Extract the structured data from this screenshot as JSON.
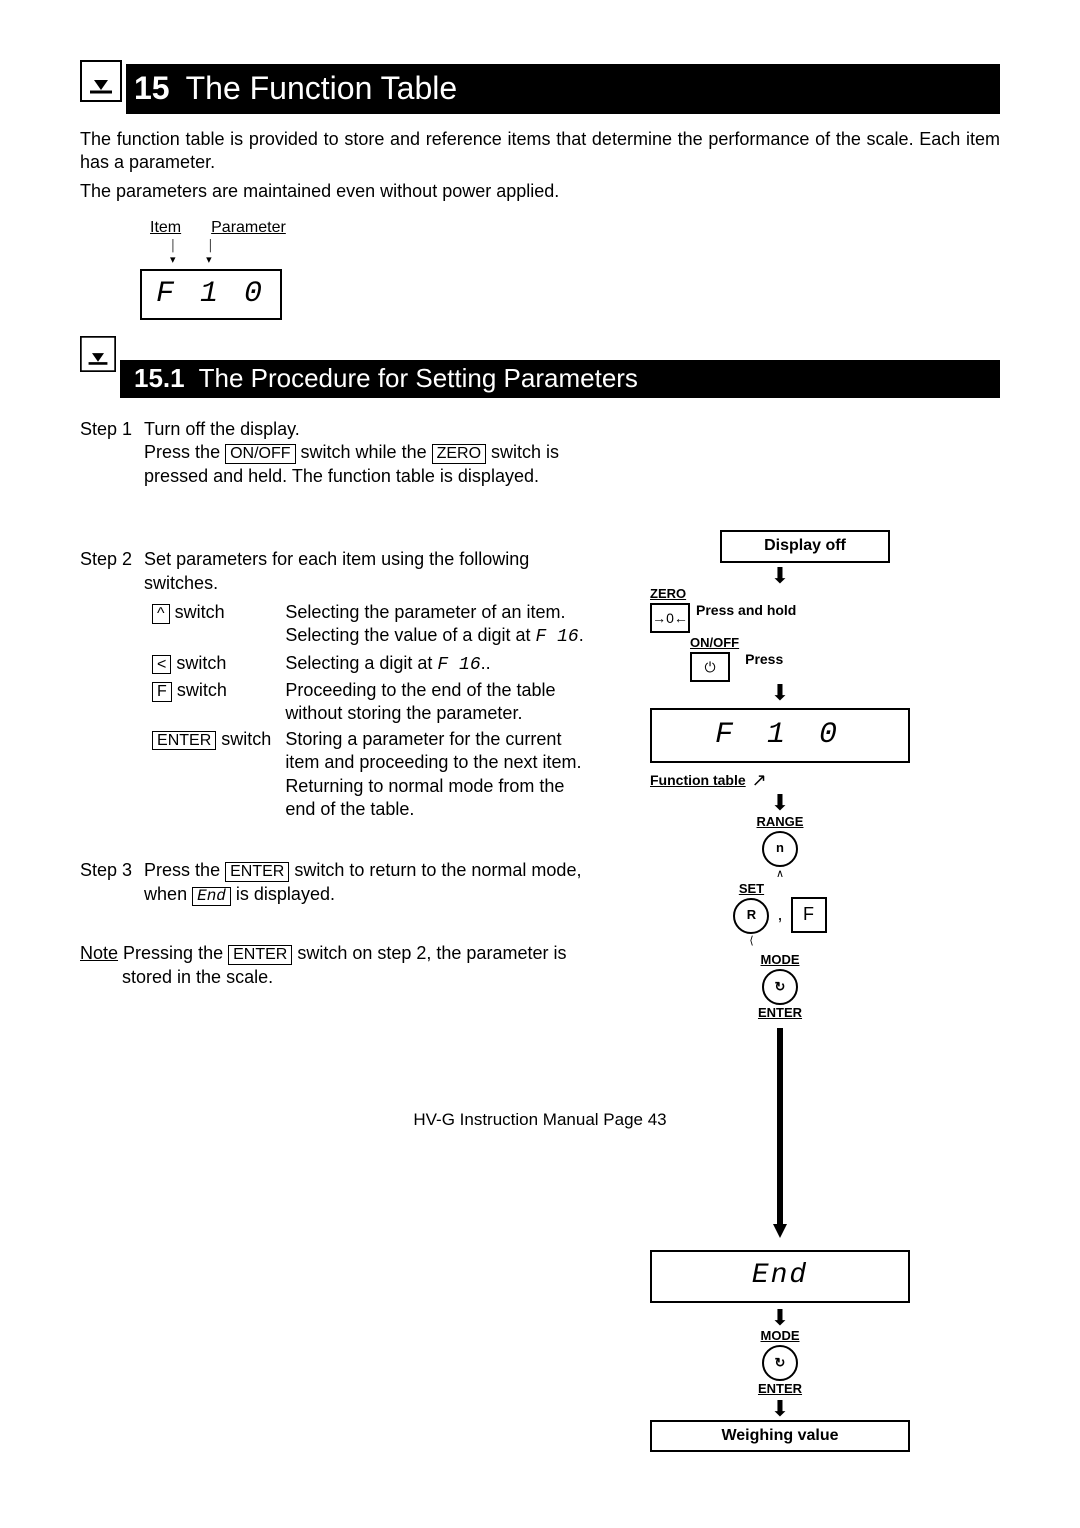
{
  "heading": {
    "number": "15",
    "title": "The Function Table"
  },
  "intro": {
    "p1": "The function table is provided to store and reference items that determine the performance of the scale. Each item has a parameter.",
    "p2": "The parameters are maintained even without power applied."
  },
  "item_param": {
    "item_label": "Item",
    "param_label": "Parameter",
    "display": "F  1  0"
  },
  "sub": {
    "number": "15.1",
    "title": "The Procedure for Setting Parameters"
  },
  "step1": {
    "label": "Step 1",
    "l1a": "Turn off the display.",
    "l2a": "Press the ",
    "key_onoff": "ON/OFF",
    "l2b": " switch while the ",
    "key_zero": "ZERO",
    "l2c": " switch is",
    "l3": "pressed and held. The function table is displayed."
  },
  "step2": {
    "label": "Step  2",
    "intro1": "Set parameters for each item using the following",
    "intro2": "switches.",
    "rows": [
      {
        "key": "^",
        "suffix": "switch",
        "desc1": "Selecting the parameter of an item.",
        "desc2a": "Selecting the value of a digit at ",
        "code": "F 16",
        "desc2b": "."
      },
      {
        "key": "<",
        "suffix": "switch",
        "desc1a": "Selecting a digit at ",
        "code": "F 16",
        "desc1b": ".."
      },
      {
        "key": "F",
        "suffix": "switch",
        "desc1": "Proceeding to the end of the table",
        "desc2": "without storing the parameter."
      },
      {
        "key": "ENTER",
        "suffix": "switch",
        "desc1": "Storing a parameter for the current",
        "desc2": "item and proceeding to the next item.",
        "desc3": "Returning to normal mode from the",
        "desc4": "end of the table."
      }
    ]
  },
  "step3": {
    "label": "Step  3",
    "l1a": "Press the ",
    "key_enter": "ENTER",
    "l1b": " switch to return to the normal mode,",
    "l2a": "when ",
    "code_end": "End",
    "l2b": " is displayed."
  },
  "note": {
    "label": "Note",
    "l1a": " Pressing the ",
    "key_enter": "ENTER",
    "l1b": " switch on step 2, the parameter is",
    "l2": "stored in the scale."
  },
  "diagram": {
    "display_off": "Display off",
    "zero_label": "ZERO",
    "press_hold": "Press and hold",
    "onoff_label": "ON/OFF",
    "press": "Press",
    "fn_display": "F  1  0",
    "fn_table_label": "Function table",
    "range": "RANGE",
    "set": "SET",
    "mode": "MODE",
    "enter": "ENTER",
    "f_key": "F",
    "end_display": "End",
    "weighing": "Weighing value"
  },
  "footer": "HV-G Instruction Manual Page 43"
}
